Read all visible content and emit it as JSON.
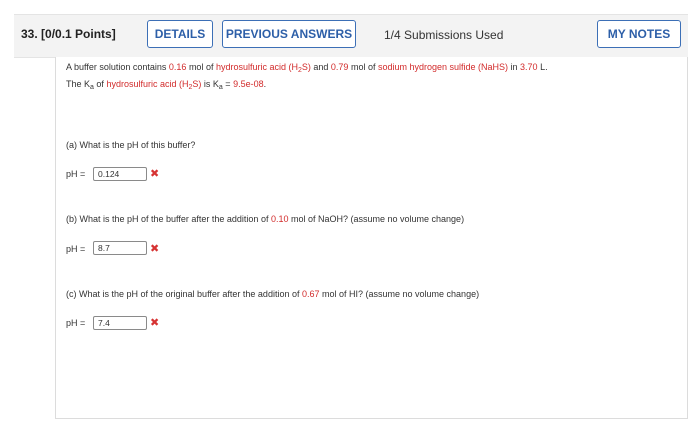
{
  "header": {
    "question_number": "33.",
    "points": "[0/0.1 Points]",
    "details_label": "DETAILS",
    "previous_answers_label": "PREVIOUS ANSWERS",
    "submissions": "1/4 Submissions Used",
    "my_notes_label": "MY NOTES"
  },
  "problem": {
    "intro_1": "A buffer solution contains ",
    "mol_acid": "0.16",
    "mol_of_1": " mol of ",
    "acid_name": "hydrosulfuric acid (H",
    "acid_sub": "2",
    "acid_tail": "S)",
    "and_text": " and ",
    "mol_salt": "0.79",
    "mol_of_2": " mol of ",
    "salt_name": "sodium hydrogen sulfide (NaHS)",
    "in_text": " in ",
    "volume": "3.70",
    "volume_unit": " L.",
    "ka_pre": "The K",
    "ka_sub": "a",
    "ka_of": " of ",
    "ka_acid_name": "hydrosulfuric acid (H",
    "ka_acid_sub": "2",
    "ka_acid_tail": "S)",
    "ka_is": " is K",
    "ka_is_sub": "a",
    "ka_eq": " = ",
    "ka_value": "9.5e-08",
    "ka_end": "."
  },
  "part_a": {
    "question": "(a) What is the pH of this buffer?",
    "ph_label": "pH =",
    "answer": "0.124",
    "status_icon": "incorrect-x-icon"
  },
  "part_b": {
    "q_pre": "(b) What is the pH of the buffer after the addition of ",
    "amount": "0.10",
    "q_post": " mol of NaOH? (assume no volume change)",
    "ph_label": "pH =",
    "answer": "8.7",
    "status_icon": "incorrect-x-icon"
  },
  "part_c": {
    "q_pre": "(c) What is the pH of the original buffer after the addition of ",
    "amount": "0.67",
    "q_post": " mol of HI? (assume no volume change)",
    "ph_label": "pH =",
    "answer": "7.4",
    "status_icon": "incorrect-x-icon"
  },
  "colors": {
    "accent_blue": "#3c6fb6",
    "highlight_red": "#d22b2b",
    "incorrect_red": "#d63333",
    "header_bg": "#f3f3f3"
  }
}
